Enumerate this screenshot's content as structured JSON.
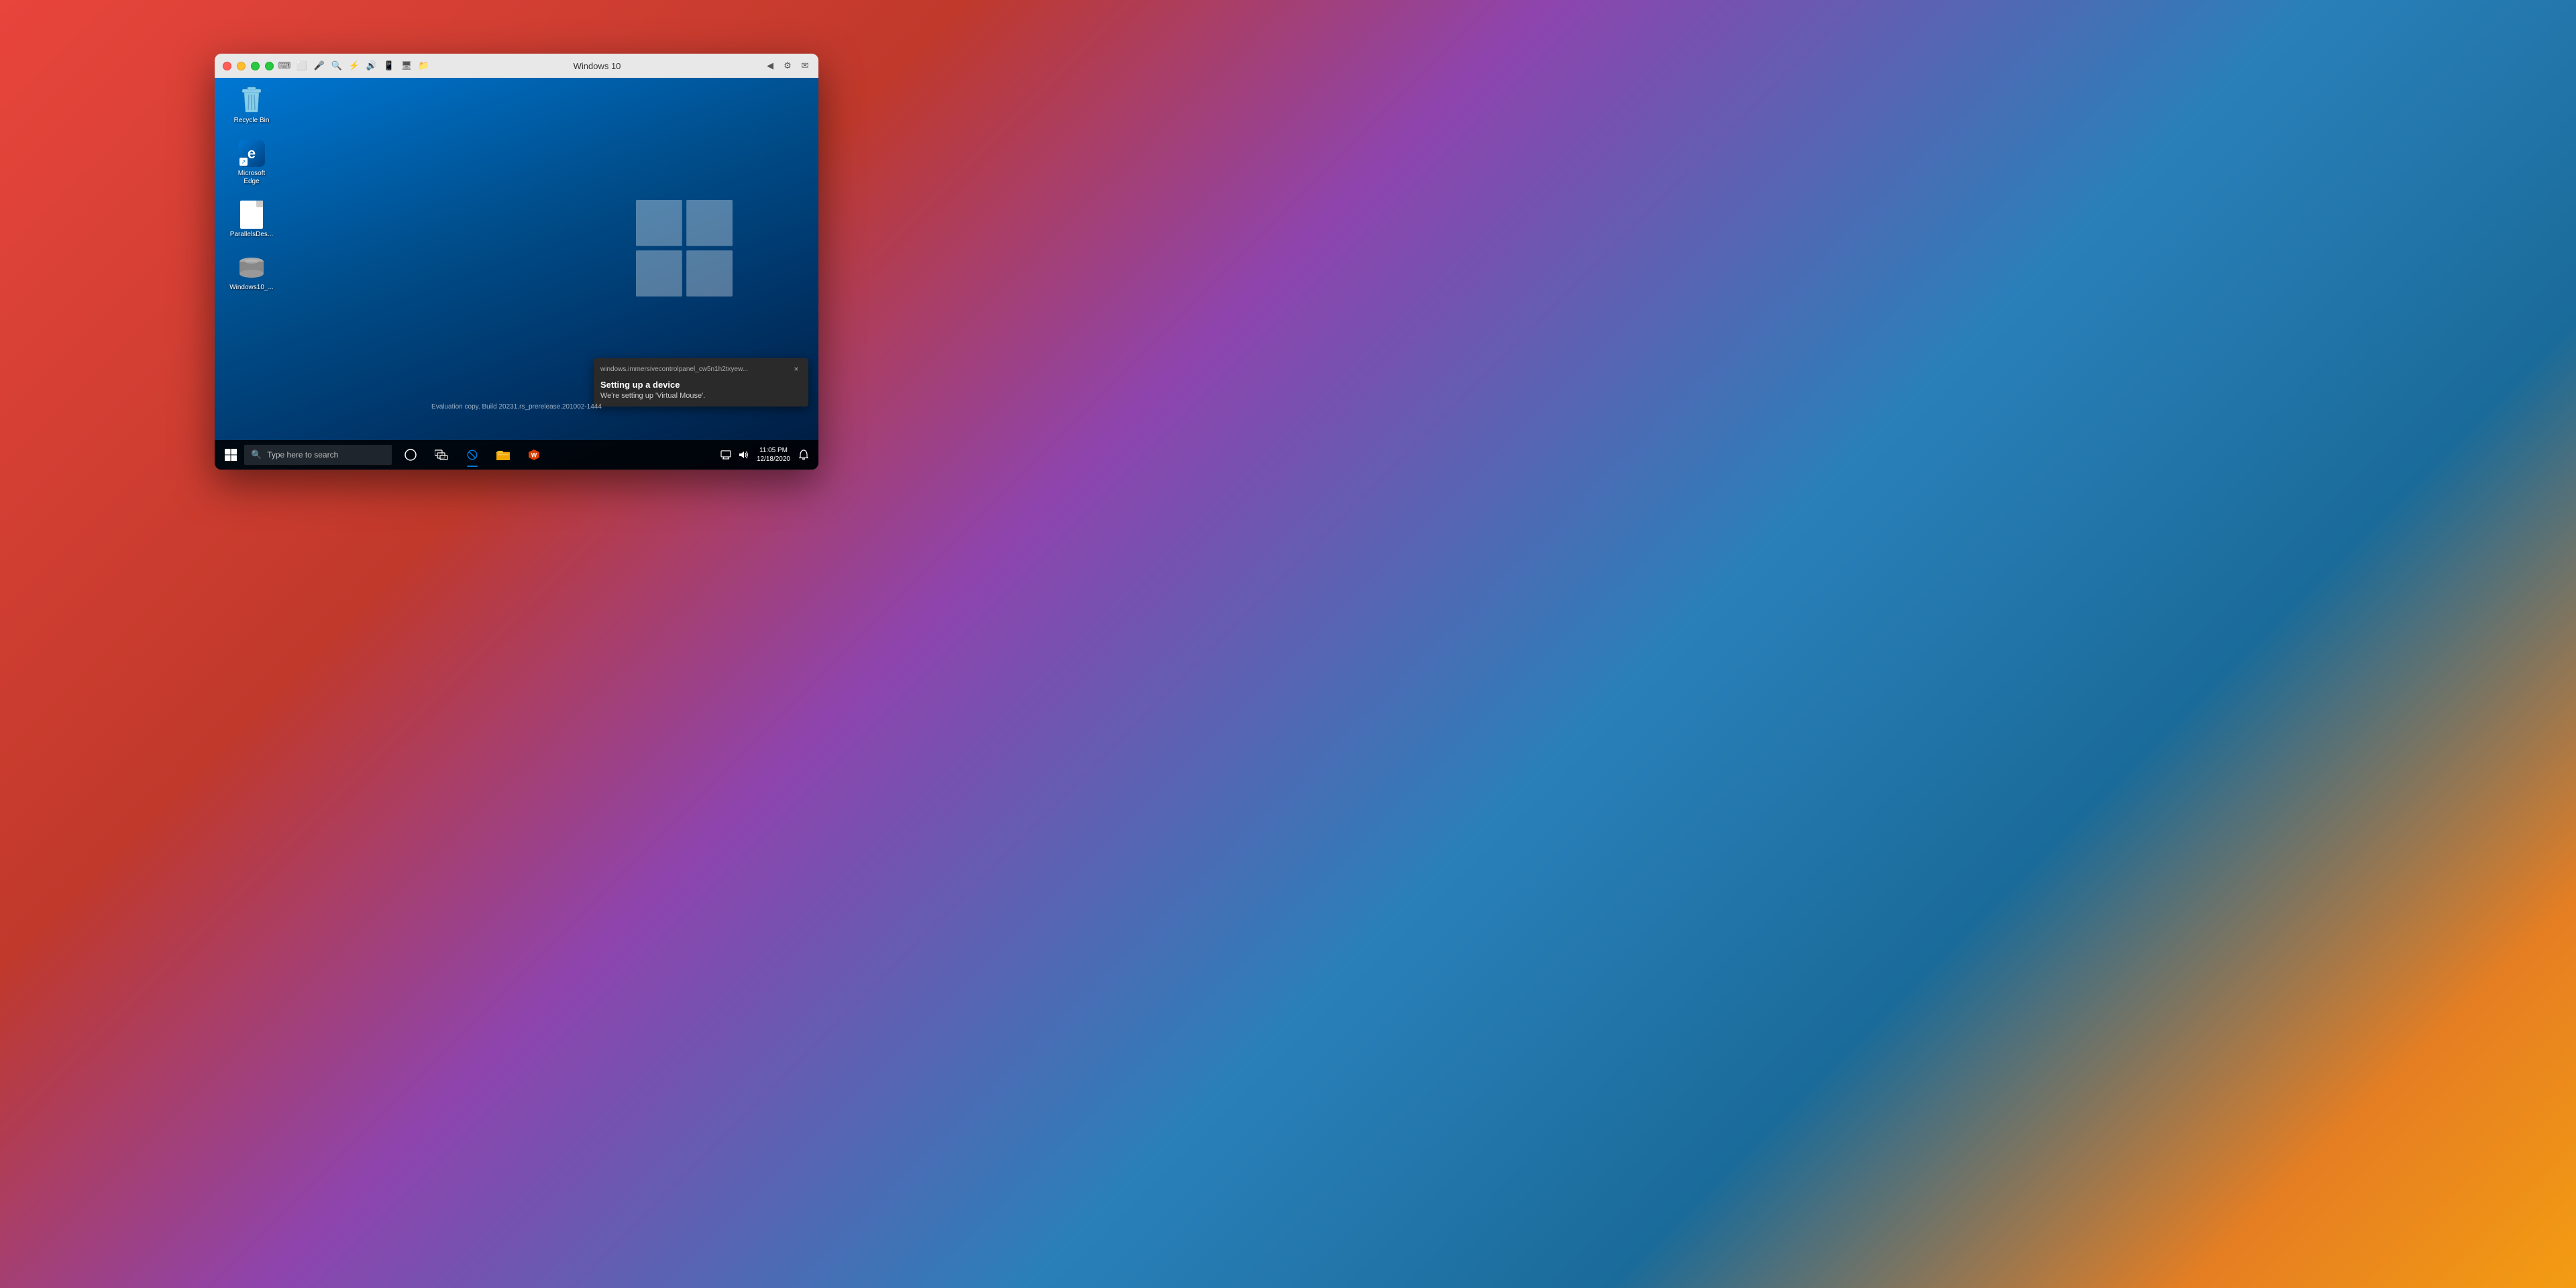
{
  "mac_bg": {
    "description": "macOS Big Sur wallpaper gradient background"
  },
  "window": {
    "title": "Windows 10",
    "traffic_lights": {
      "close_label": "close",
      "minimize_label": "minimize",
      "maximize_label": "maximize",
      "fullscreen_label": "fullscreen"
    },
    "toolbar_icons": [
      "keyboard",
      "capture",
      "microphone",
      "zoom",
      "usb",
      "sound",
      "phone",
      "display",
      "folder",
      "back",
      "settings",
      "email"
    ]
  },
  "desktop": {
    "icons": [
      {
        "id": "recycle-bin",
        "label": "Recycle Bin",
        "type": "recycle"
      },
      {
        "id": "microsoft-edge",
        "label": "Microsoft\nEdge",
        "type": "edge"
      },
      {
        "id": "parallels-desktop",
        "label": "ParallelsDes...",
        "type": "doc"
      },
      {
        "id": "windows10-iso",
        "label": "Windows10_...",
        "type": "drive"
      }
    ]
  },
  "notification": {
    "app_name": "windows.immersivecontrolpanel_cw5n1h2txyew...",
    "title": "Setting up a device",
    "body": "We're setting up 'Virtual Mouse'.",
    "close_label": "×"
  },
  "eval_copy": {
    "text": "Evaluation copy. Build 20231.rs_prerelease.201002-1444"
  },
  "taskbar": {
    "start_icon": "⊞",
    "search_placeholder": "Type here to search",
    "search_icon": "🔍",
    "center_buttons": [
      {
        "id": "cortana",
        "type": "circle"
      },
      {
        "id": "task-view",
        "type": "taskview"
      },
      {
        "id": "edge",
        "type": "edge"
      },
      {
        "id": "explorer",
        "type": "folder"
      },
      {
        "id": "office",
        "type": "office"
      }
    ],
    "sys_icons": [
      "notification",
      "sound"
    ],
    "clock": {
      "time": "11:05 PM",
      "date": "12/18/2020"
    }
  }
}
